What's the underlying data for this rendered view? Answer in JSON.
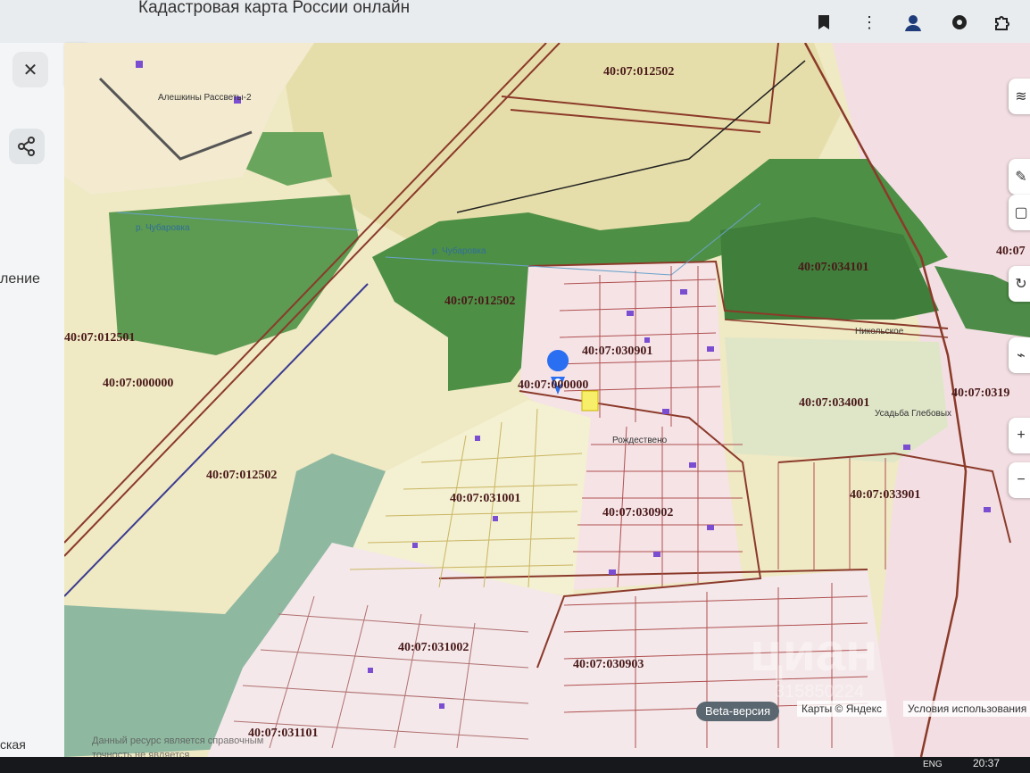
{
  "browser": {
    "tab_title": "Кадастровая карта России онлайн",
    "icons": [
      "bookmark-icon",
      "more-menu-icon",
      "profile-icon",
      "extension-icon",
      "puzzle-icon"
    ]
  },
  "sidebar": {
    "partial_label_1": "ление",
    "partial_label_2": "ская",
    "icons": [
      "close-icon",
      "share-icon",
      "chevron-left-icon"
    ]
  },
  "map": {
    "cadastral_labels": [
      "40:07:012502",
      "40:07:012502",
      "40:07:012501",
      "40:07:000000",
      "40:07:012502",
      "40:07:034101",
      "40:07:030901",
      "40:07:034001",
      "40:07:0319",
      "40:07:033901",
      "40:07:031001",
      "40:07:030902",
      "40:07:031002",
      "40:07:030903",
      "40:07:031101",
      "40:07:000000",
      "40:07"
    ],
    "place_labels": [
      "Алешкины Рассветы-2",
      "р. Чубаровка",
      "р. Чубаровка",
      "Никольское",
      "Усадьба Глебовых",
      "Рождествено"
    ],
    "beta_label": "Beta-версия",
    "copyright": "Карты © Яндекс",
    "terms": "Условия использования",
    "bottom_note_1": "Данный ресурс является справочным",
    "bottom_note_2": "точность не является",
    "watermark": "циан",
    "watermark_id": "315850224"
  },
  "system": {
    "lang": "ENG",
    "time": "20:37"
  }
}
